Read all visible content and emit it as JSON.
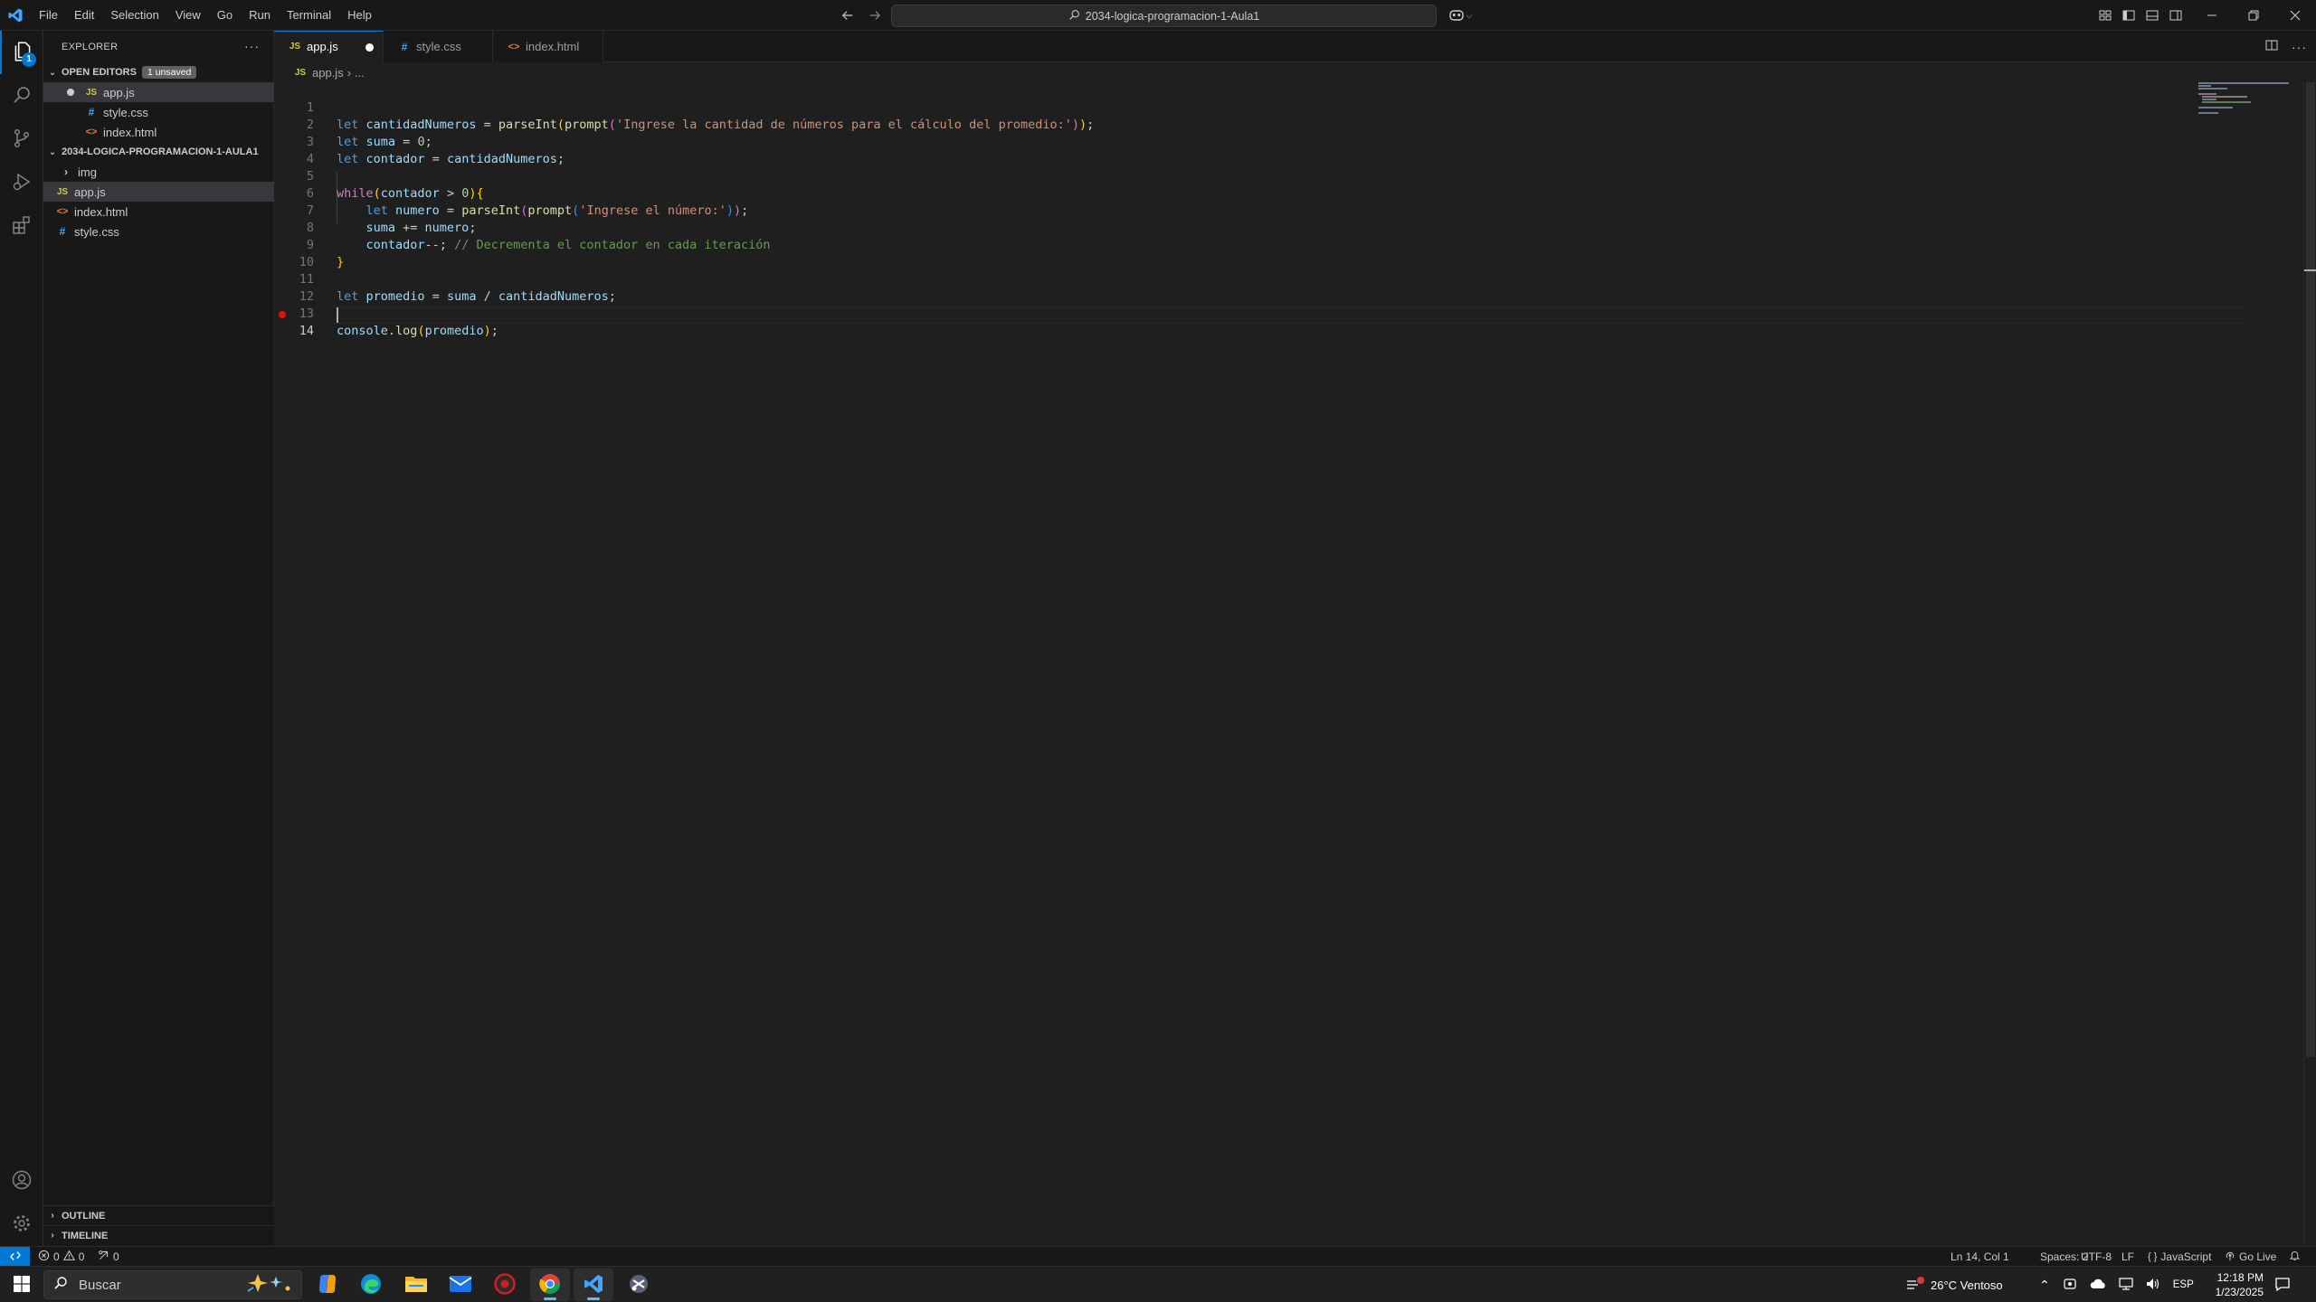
{
  "titlebar": {
    "menu": [
      "File",
      "Edit",
      "Selection",
      "View",
      "Go",
      "Run",
      "Terminal",
      "Help"
    ],
    "command_center": "2034-logica-programacion-1-Aula1"
  },
  "activity": {
    "explorer_badge": "1"
  },
  "sidebar": {
    "title": "EXPLORER",
    "open_editors": {
      "header": "OPEN EDITORS",
      "badge": "1 unsaved",
      "items": [
        "app.js",
        "style.css",
        "index.html"
      ]
    },
    "folder": {
      "header": "2034-LOGICA-PROGRAMACION-1-AULA1",
      "items": [
        "img",
        "app.js",
        "index.html",
        "style.css"
      ]
    },
    "outline": "OUTLINE",
    "timeline": "TIMELINE"
  },
  "tabs": [
    {
      "label": "app.js",
      "icon": "JS",
      "dirty": true
    },
    {
      "label": "style.css",
      "icon": "#"
    },
    {
      "label": "index.html",
      "icon": "<>"
    }
  ],
  "breadcrumb": {
    "file": "app.js",
    "rest": "..."
  },
  "editor": {
    "language": "javascript",
    "line_numbers": [
      "1",
      "2",
      "3",
      "4",
      "5",
      "6",
      "7",
      "8",
      "9",
      "10",
      "11",
      "12",
      "13",
      "14"
    ],
    "lines": [
      "let cantidadNumeros = parseInt(prompt('Ingrese la cantidad de números para el cálculo del promedio:'));",
      "let suma = 0;",
      "let contador = cantidadNumeros;",
      "",
      "while(contador > 0){",
      "    let numero = parseInt(prompt('Ingrese el número:'));",
      "    suma += numero;",
      "    contador--; // Decrementa el contador en cada iteración",
      "}",
      "",
      "let promedio = suma / cantidadNumeros;",
      "",
      "console.log(promedio);",
      ""
    ],
    "current_line": 14
  },
  "statusbar": {
    "errors": "0",
    "warnings": "0",
    "ports": "0",
    "position": "Ln 14, Col 1",
    "spaces": "Spaces: 2",
    "encoding": "UTF-8",
    "eol": "LF",
    "language": "JavaScript",
    "golive": "Go Live"
  },
  "taskbar": {
    "search_placeholder": "Buscar",
    "weather": "26°C  Ventoso",
    "lang": "ESP",
    "time": "12:18 PM",
    "date": "1/23/2025"
  },
  "colors": {
    "accent": "#0078d4",
    "editor_bg": "#1f1f1f",
    "chrome_bg": "#181818"
  }
}
